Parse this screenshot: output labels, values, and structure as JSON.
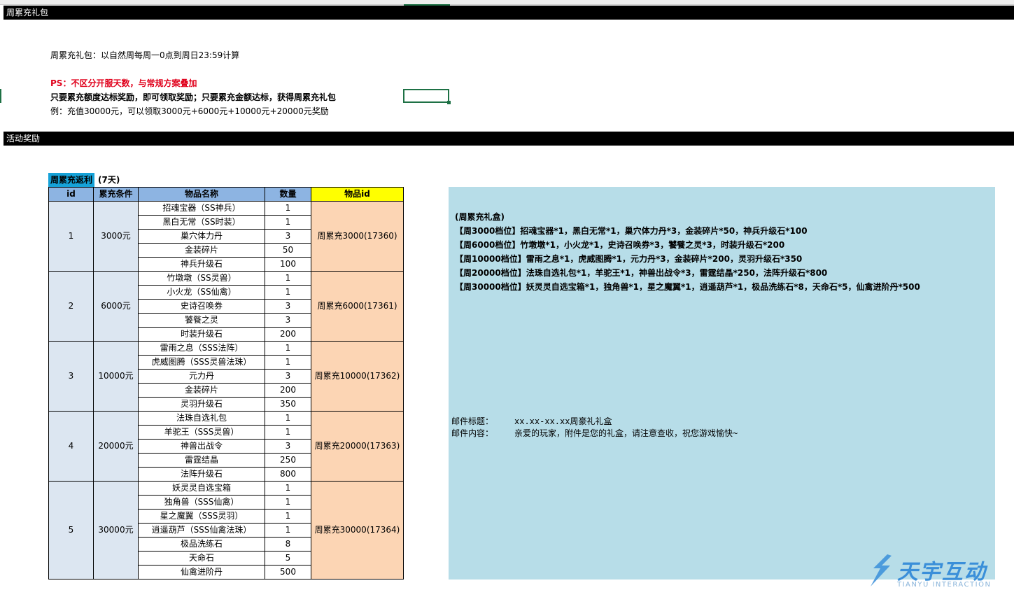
{
  "banner1": "周累充礼包",
  "intro": "周累充礼包：以自然周每周一0点到周日23:59计算",
  "ps": "PS：不区分开服天数，与常规方案叠加",
  "rule": "只要累充额度达标奖励，即可领取奖励；只要累充金额达标，获得周累充礼包",
  "example": "例：充值30000元，可以领取3000元+6000元+10000元+20000元奖励",
  "banner2": "活动奖励",
  "table_title": "周累充返利",
  "table_sub": "(7天)",
  "headers": {
    "id": "id",
    "cond": "累充条件",
    "name": "物品名称",
    "qty": "数量",
    "itemid": "物品id"
  },
  "tiers": [
    {
      "id": "1",
      "cond": "3000元",
      "box": "周累充3000(17360)",
      "items": [
        [
          "招魂宝器（SS神兵）",
          "1"
        ],
        [
          "黑白无常（SS时装）",
          "1"
        ],
        [
          "巢穴体力丹",
          "3"
        ],
        [
          "金装碎片",
          "50"
        ],
        [
          "神兵升级石",
          "100"
        ]
      ]
    },
    {
      "id": "2",
      "cond": "6000元",
      "box": "周累充6000(17361)",
      "items": [
        [
          "竹墩墩（SS灵兽）",
          "1"
        ],
        [
          "小火龙（SS仙禽）",
          "1"
        ],
        [
          "史诗召唤券",
          "3"
        ],
        [
          "饕餮之灵",
          "3"
        ],
        [
          "时装升级石",
          "200"
        ]
      ]
    },
    {
      "id": "3",
      "cond": "10000元",
      "box": "周累充10000(17362)",
      "items": [
        [
          "雷雨之息（SSS法阵）",
          "1"
        ],
        [
          "虎威图腾（SSS灵兽法珠）",
          "1"
        ],
        [
          "元力丹",
          "3"
        ],
        [
          "金装碎片",
          "200"
        ],
        [
          "灵羽升级石",
          "350"
        ]
      ]
    },
    {
      "id": "4",
      "cond": "20000元",
      "box": "周累充20000(17363)",
      "items": [
        [
          "法珠自选礼包",
          "1"
        ],
        [
          "羊驼王（SSS灵兽）",
          "1"
        ],
        [
          "神兽出战令",
          "3"
        ],
        [
          "雷霆结晶",
          "250"
        ],
        [
          "法阵升级石",
          "800"
        ]
      ]
    },
    {
      "id": "5",
      "cond": "30000元",
      "box": "周累充30000(17364)",
      "items": [
        [
          "妖灵灵自选宝箱",
          "1"
        ],
        [
          "独角兽（SSS仙禽）",
          "1"
        ],
        [
          "星之魔翼（SSS灵羽）",
          "1"
        ],
        [
          "逍遥葫芦（SSS仙禽法珠）",
          "1"
        ],
        [
          "极品洗练石",
          "8"
        ],
        [
          "天命石",
          "5"
        ],
        [
          "仙禽进阶丹",
          "500"
        ]
      ]
    }
  ],
  "panel_lines": [
    "(周累充礼盒)",
    "【周3000档位】招魂宝器*1，黑白无常*1，巢穴体力丹*3，金装碎片*50，神兵升级石*100",
    "【周6000档位】竹墩墩*1，小火龙*1，史诗召唤券*3，饕餮之灵*3，时装升级石*200",
    "【周10000档位】雷雨之息*1，虎威图腾*1，元力丹*3，金装碎片*200，灵羽升级石*350",
    "【周20000档位】法珠自选礼包*1，羊驼王*1，神兽出战令*3，雷霆结晶*250，法阵升级石*800",
    "【周30000档位】妖灵灵自选宝箱*1，独角兽*1，星之魔翼*1，逍遥葫芦*1，极品洗练石*8，天命石*5，仙禽进阶丹*500"
  ],
  "mail_title_label": "邮件标题：",
  "mail_title_value": "xx.xx-xx.xx周豪礼礼盒",
  "mail_content_label": "邮件内容：",
  "mail_content_value": "亲爱的玩家，附件是您的礼盒，请注意查收，祝您游戏愉快~",
  "logo_text": "天宇互动",
  "logo_sub": "TIANYU INTERACTION",
  "colors": {
    "header_blue": "#8db4e2",
    "itemid_yellow": "#ffff00",
    "id_fill": "#dce6f1",
    "box_fill": "#fcd5b4",
    "panel": "#b7dde8",
    "title_blue": "#16a2d8",
    "red": "#e0001b"
  }
}
